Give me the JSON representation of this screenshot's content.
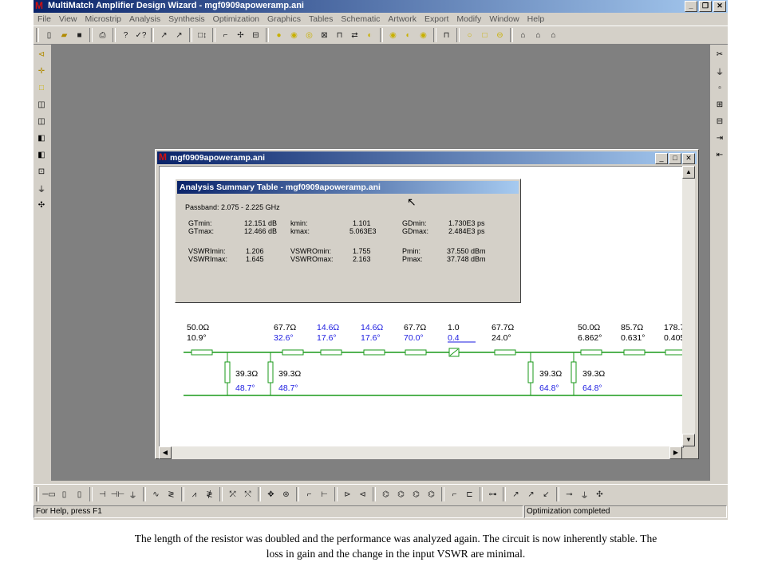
{
  "window": {
    "title": "MultiMatch Amplifier Design Wizard - mgf0909apoweramp.ani",
    "logo": "M"
  },
  "menu": [
    "File",
    "View",
    "Microstrip",
    "Analysis",
    "Synthesis",
    "Optimization",
    "Graphics",
    "Tables",
    "Schematic",
    "Artwork",
    "Export",
    "Modify",
    "Window",
    "Help"
  ],
  "child": {
    "title": "mgf0909apoweramp.ani"
  },
  "summary": {
    "title": "Analysis Summary Table - mgf0909apoweramp.ani",
    "passband": "Passband: 2.075 - 2.225 GHz",
    "col1": [
      [
        "GTmin:",
        "12.151 dB"
      ],
      [
        "GTmax:",
        "12.466 dB"
      ],
      [
        "VSWRImin:",
        "1.206"
      ],
      [
        "VSWRImax:",
        "1.645"
      ]
    ],
    "col2": [
      [
        "kmin:",
        "1.101"
      ],
      [
        "kmax:",
        "5.063E3"
      ],
      [
        "VSWROmin:",
        "1.755"
      ],
      [
        "VSWROmax:",
        "2.163"
      ]
    ],
    "col3": [
      [
        "GDmin:",
        "1.730E3 ps"
      ],
      [
        "GDmax:",
        "2.484E3 ps"
      ],
      [
        "Pmin:",
        "37.550 dBm"
      ],
      [
        "Pmax:",
        "37.748 dBm"
      ]
    ]
  },
  "circuit": {
    "top_labels": [
      {
        "z": "50.0Ω",
        "e": "10.9°",
        "blue": false
      },
      {
        "z": "67.7Ω",
        "e": "32.6°",
        "blue": "e"
      },
      {
        "z": "14.6Ω",
        "e": "17.6°",
        "blue": "both"
      },
      {
        "z": "14.6Ω",
        "e": "17.6°",
        "blue": "both"
      },
      {
        "z": "67.7Ω",
        "e": "70.0°",
        "blue": "e"
      },
      {
        "z": "1.0",
        "e": "0.4",
        "blue": "e"
      },
      {
        "z": "67.7Ω",
        "e": "24.0°",
        "blue": false
      },
      {
        "z": "50.0Ω",
        "e": "6.862°",
        "blue": false
      },
      {
        "z": "85.7Ω",
        "e": "0.631°",
        "blue": false
      },
      {
        "z": "178.7",
        "e": "0.405",
        "blue": false
      }
    ],
    "bottom_labels": [
      {
        "z": "39.3Ω",
        "e": "48.7°"
      },
      {
        "z": "39.3Ω",
        "e": "48.7°"
      },
      {
        "z": "39.3Ω",
        "e": "64.8°"
      },
      {
        "z": "39.3Ω",
        "e": "64.8°"
      }
    ]
  },
  "status": {
    "help": "For Help, press F1",
    "state": "Optimization completed"
  },
  "caption": {
    "line1": "The length of the resistor was doubled and the performance was analyzed again. The circuit is now inherently stable. The",
    "line2": "loss in gain and the change in the input VSWR are minimal."
  },
  "colors": {
    "green": "#1a9a1a",
    "blue": "#1a1ae0",
    "title_blue": "#0a246a"
  },
  "icons": [
    "new-icon",
    "open-icon",
    "save-icon",
    "print-icon",
    "help-icon",
    "context-help-icon",
    "minimize-icon",
    "maximize-icon",
    "close-icon",
    "arrow-cursor-icon"
  ]
}
